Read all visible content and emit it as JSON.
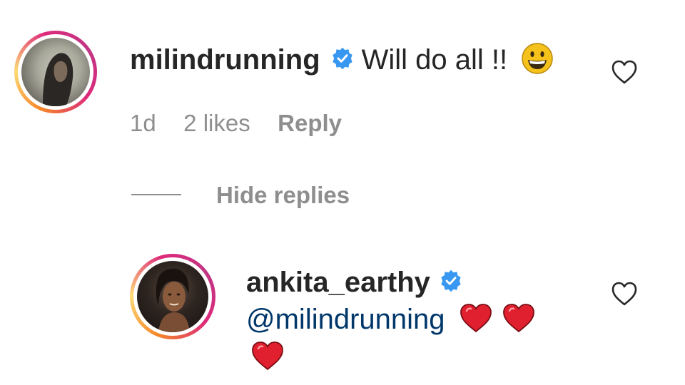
{
  "comment": {
    "username": "milindrunning",
    "text": "Will do all !!",
    "emoji": "grinning-face",
    "time": "1d",
    "likes": "2 likes",
    "reply_label": "Reply"
  },
  "thread": {
    "hide_replies_label": "Hide replies"
  },
  "reply": {
    "username": "ankita_earthy",
    "mention": "@milindrunning",
    "emojis": [
      "red-heart",
      "red-heart",
      "red-heart"
    ]
  },
  "colors": {
    "verified_badge": "#3897f0",
    "mention": "#00376b",
    "meta_text": "#8e8e8e",
    "heart_emoji": "#e0202e"
  }
}
